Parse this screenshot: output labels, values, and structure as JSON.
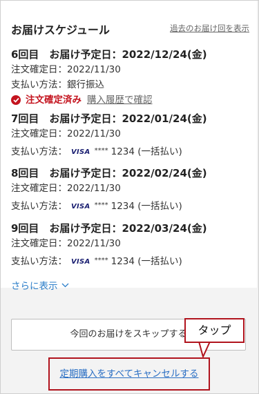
{
  "header": {
    "title": "お届けスケジュール",
    "past_link": "過去のお届け回を表示"
  },
  "deliveries": [
    {
      "title": "6回目　お届け予定日：2022/12/24(金)",
      "order_date": "注文確定日：2022/11/30",
      "payment_text": "支払い方法：銀行振込",
      "status": "注文確定済み",
      "history_link": "購入履歴で確認"
    },
    {
      "title": "7回目　お届け予定日：2022/01/24(金)",
      "order_date": "注文確定日：2022/11/30",
      "payment_label": "支払い方法：",
      "card_brand": "VISA",
      "card_mask": "****",
      "card_detail": "1234 (一括払い)"
    },
    {
      "title": "8回目　お届け予定日：2022/02/24(金)",
      "order_date": "注文確定日：2022/11/30",
      "payment_label": "支払い方法：",
      "card_brand": "VISA",
      "card_mask": "****",
      "card_detail": "1234 (一括払い)"
    },
    {
      "title": "9回目　お届け予定日：2022/03/24(金)",
      "order_date": "注文確定日：2022/11/30",
      "payment_label": "支払い方法：",
      "card_brand": "VISA",
      "card_mask": "****",
      "card_detail": "1234 (一括払い)"
    }
  ],
  "show_more": "さらに表示",
  "skip_button": "今回のお届けをスキップする",
  "cancel_link": "定期購入をすべてキャンセルする",
  "annotation": {
    "text": "タップ"
  },
  "colors": {
    "status_red": "#c4141f",
    "link_blue": "#2a6fc4",
    "annotation_red": "#b0121c",
    "visa_navy": "#1a1f71"
  },
  "icons": {
    "status": "check-circle-icon",
    "show_more": "chevron-down-icon"
  }
}
